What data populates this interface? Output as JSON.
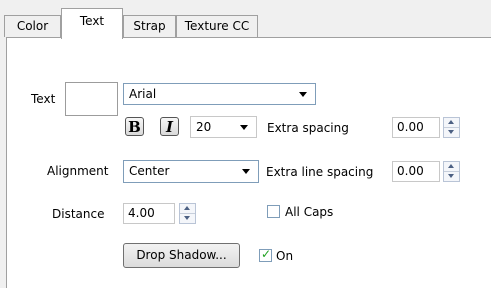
{
  "tabs": [
    {
      "label": "Color"
    },
    {
      "label": "Text"
    },
    {
      "label": "Strap"
    },
    {
      "label": "Texture CC"
    }
  ],
  "text_row": {
    "label": "Text",
    "font_value": "Arial"
  },
  "style_row": {
    "bold_glyph": "B",
    "italic_glyph": "I",
    "size_value": "20",
    "extra_spacing_label": "Extra spacing",
    "extra_spacing_value": "0.00"
  },
  "alignment_row": {
    "label": "Alignment",
    "value": "Center",
    "extra_line_spacing_label": "Extra line spacing",
    "extra_line_spacing_value": "0.00"
  },
  "distance_row": {
    "label": "Distance",
    "value": "4.00",
    "all_caps_label": "All Caps",
    "all_caps_checked": false
  },
  "shadow_row": {
    "button_label": "Drop Shadow...",
    "on_label": "On",
    "on_checked": true
  }
}
